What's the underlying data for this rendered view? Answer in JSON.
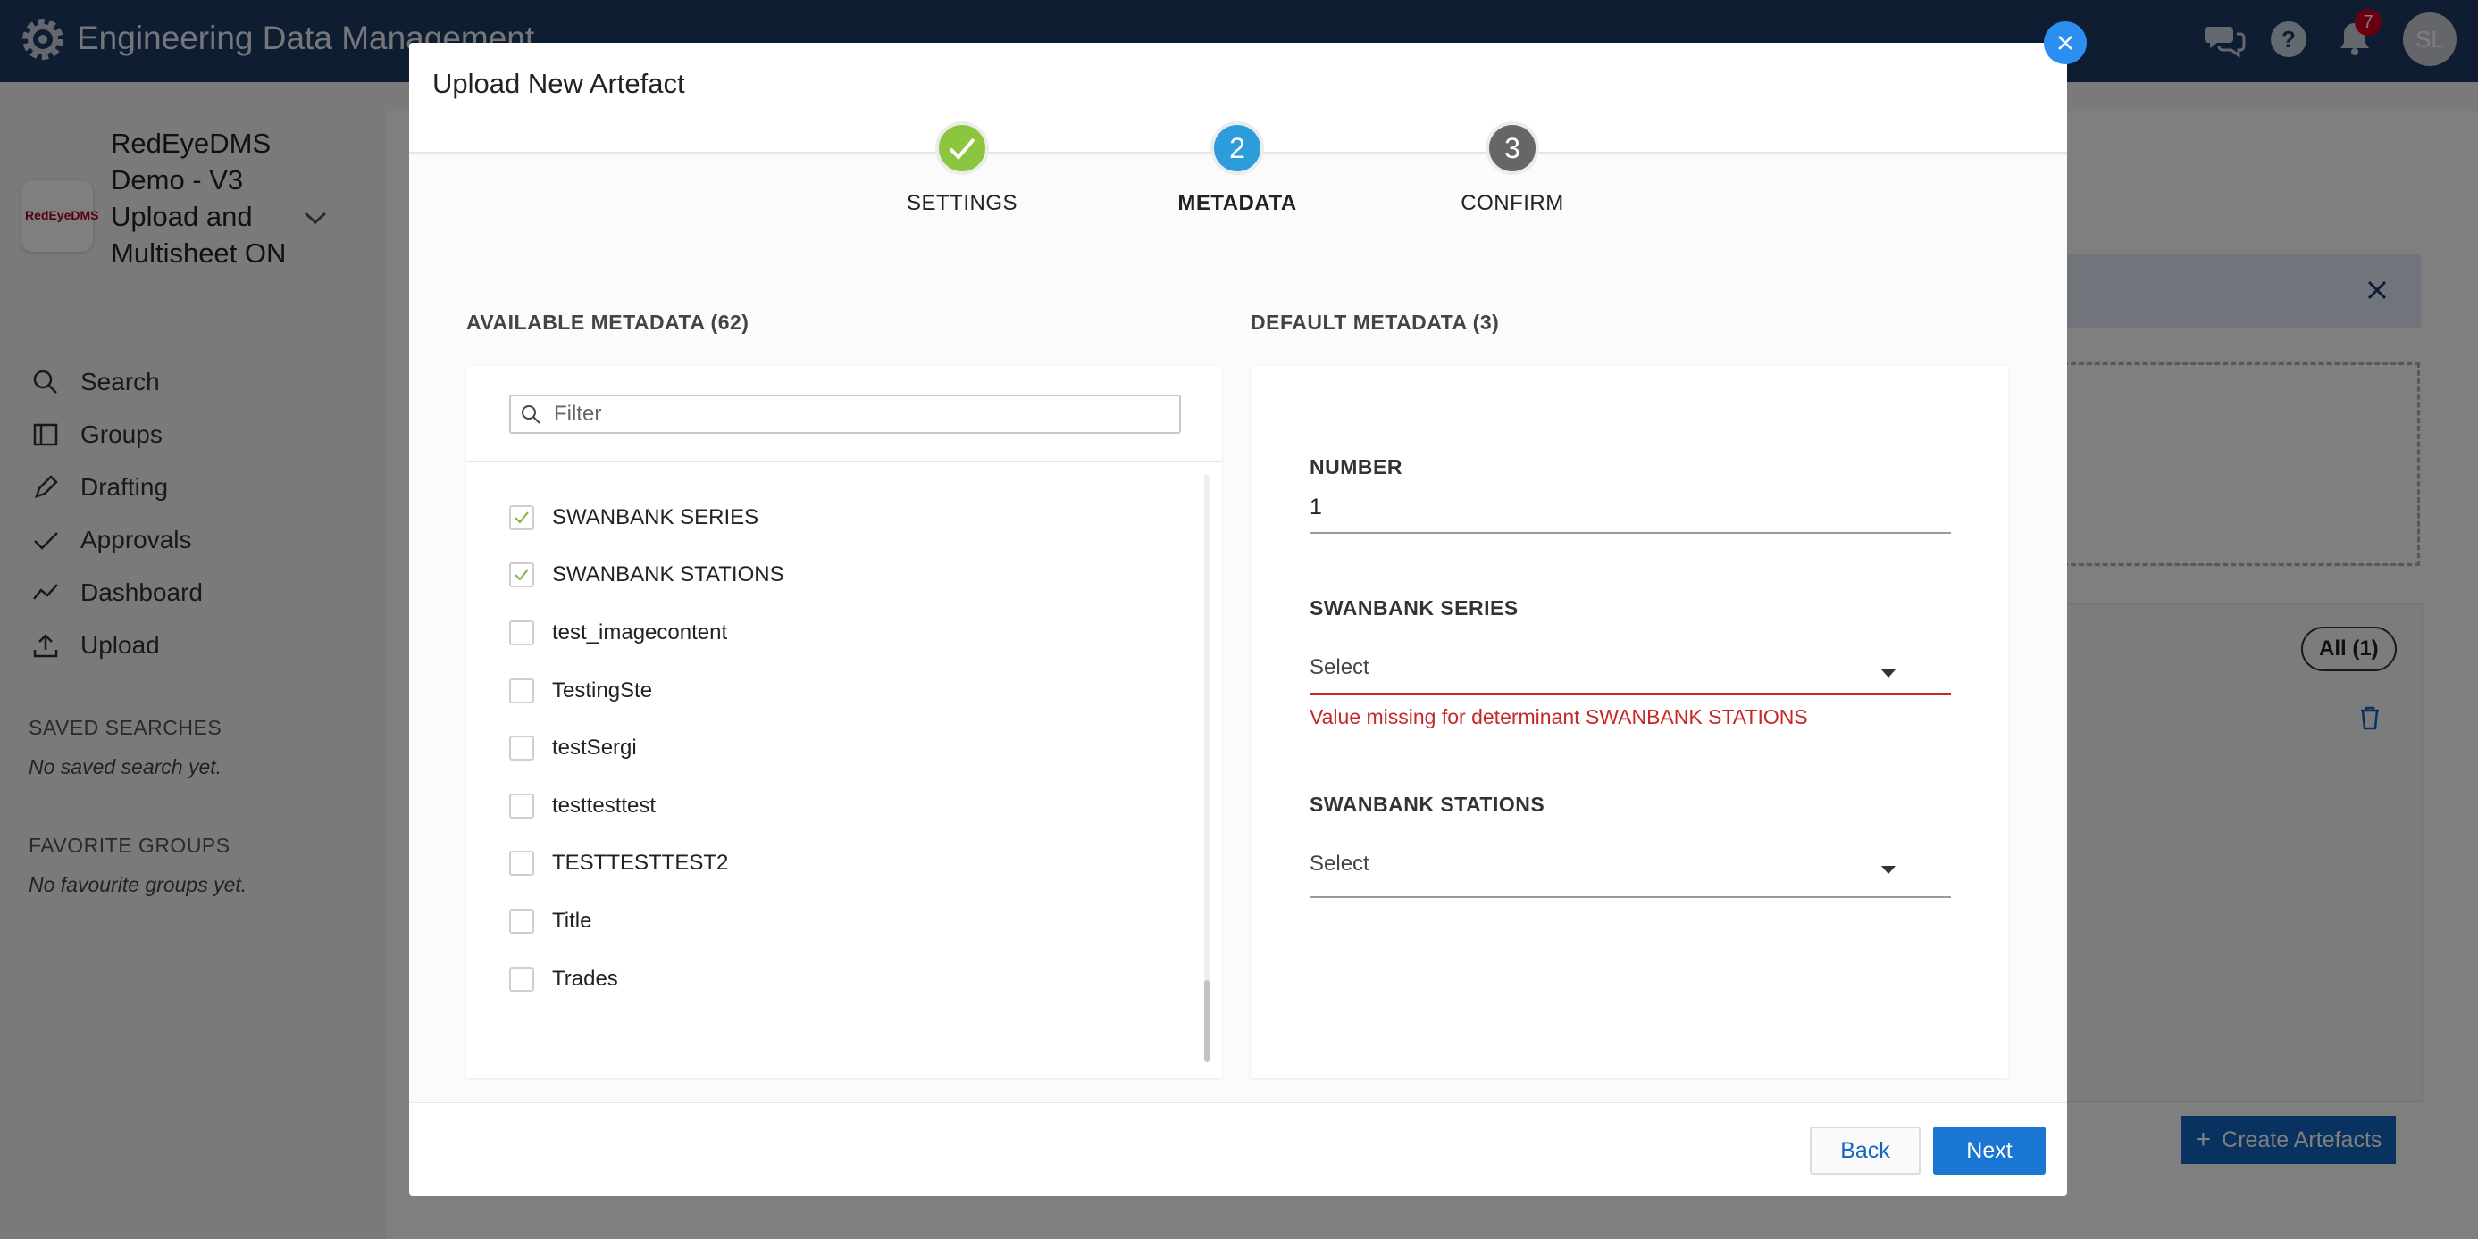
{
  "app": {
    "title": "Engineering Data Management",
    "notifications_count": "7",
    "user_initials": "SL"
  },
  "sidebar": {
    "project": {
      "logo_text": "RedEyeDMS",
      "name": "RedEyeDMS Demo - V3 Upload and Multisheet ON"
    },
    "nav": [
      {
        "label": "Search",
        "icon": "search-icon"
      },
      {
        "label": "Groups",
        "icon": "groups-icon"
      },
      {
        "label": "Drafting",
        "icon": "pencil-icon"
      },
      {
        "label": "Approvals",
        "icon": "check-icon"
      },
      {
        "label": "Dashboard",
        "icon": "chart-line-icon"
      },
      {
        "label": "Upload",
        "icon": "upload-icon"
      }
    ],
    "saved_searches": {
      "title": "SAVED SEARCHES",
      "empty": "No saved search yet."
    },
    "favorite_groups": {
      "title": "FAVORITE GROUPS",
      "empty": "No favourite groups yet."
    }
  },
  "background": {
    "all_pill": "All (1)",
    "create_button": "Create Artefacts"
  },
  "modal": {
    "title": "Upload New Artefact",
    "steps": [
      {
        "number": "1",
        "label": "SETTINGS",
        "state": "done"
      },
      {
        "number": "2",
        "label": "METADATA",
        "state": "active"
      },
      {
        "number": "3",
        "label": "CONFIRM",
        "state": "pending"
      }
    ],
    "available": {
      "title": "AVAILABLE METADATA (62)",
      "filter_placeholder": "Filter",
      "items": [
        {
          "label": "SWANBANK SERIES",
          "checked": true
        },
        {
          "label": "SWANBANK STATIONS",
          "checked": true
        },
        {
          "label": "test_imagecontent",
          "checked": false
        },
        {
          "label": "TestingSte",
          "checked": false
        },
        {
          "label": "testSergi",
          "checked": false
        },
        {
          "label": "testtesttest",
          "checked": false
        },
        {
          "label": "TESTTESTTEST2",
          "checked": false
        },
        {
          "label": "Title",
          "checked": false
        },
        {
          "label": "Trades",
          "checked": false
        }
      ]
    },
    "default": {
      "title": "DEFAULT METADATA (3)",
      "fields": {
        "number": {
          "label": "NUMBER",
          "value": "1"
        },
        "series": {
          "label": "SWANBANK SERIES",
          "placeholder": "Select",
          "error": "Value missing for determinant SWANBANK STATIONS"
        },
        "stations": {
          "label": "SWANBANK STATIONS",
          "placeholder": "Select"
        }
      }
    },
    "buttons": {
      "back": "Back",
      "next": "Next"
    }
  },
  "colors": {
    "topbar": "#1f3a67",
    "primary": "#1976d2",
    "step_done": "#8cc63f",
    "step_active": "#2d9cdb",
    "step_pending": "#666666",
    "error": "#c62828"
  }
}
